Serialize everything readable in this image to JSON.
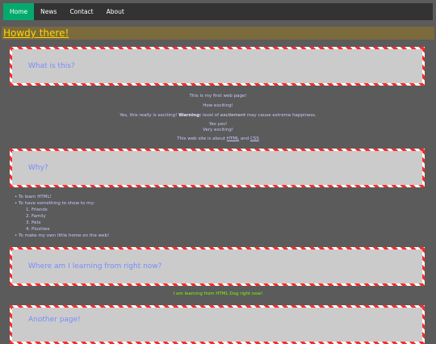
{
  "nav": {
    "items": [
      "Home",
      "News",
      "Contact",
      "About"
    ]
  },
  "banner": {
    "title": "Howdy there!"
  },
  "sections": [
    {
      "heading": "What is this?"
    },
    {
      "heading": "Why?"
    },
    {
      "heading": "Where am I learning from right now?"
    },
    {
      "heading": "Another page!"
    }
  ],
  "intro": {
    "line1": "This is my first web page!",
    "line2": "How exciting!",
    "line3_pre": "Yes, this really is exciting!",
    "line3_warning": "Warning:",
    "line3_mid": "level of",
    "line3_em": "excitement",
    "line3_post": "may cause extreme happiness.",
    "line4": "Yes yes!",
    "line5": "Very exciting!",
    "line6_pre": "This web site is about",
    "line6_html": "HTML",
    "line6_and": "and",
    "line6_css": "CSS"
  },
  "why": {
    "items": [
      "To learn HTML!",
      "To have something to show to my:",
      "To make my own little home on the web!"
    ],
    "sub": [
      "1. Friends",
      "2. Family",
      "3. Pets",
      "4. Plushies"
    ]
  },
  "learning": {
    "text": "I am learning from HTML Dog right now!"
  }
}
